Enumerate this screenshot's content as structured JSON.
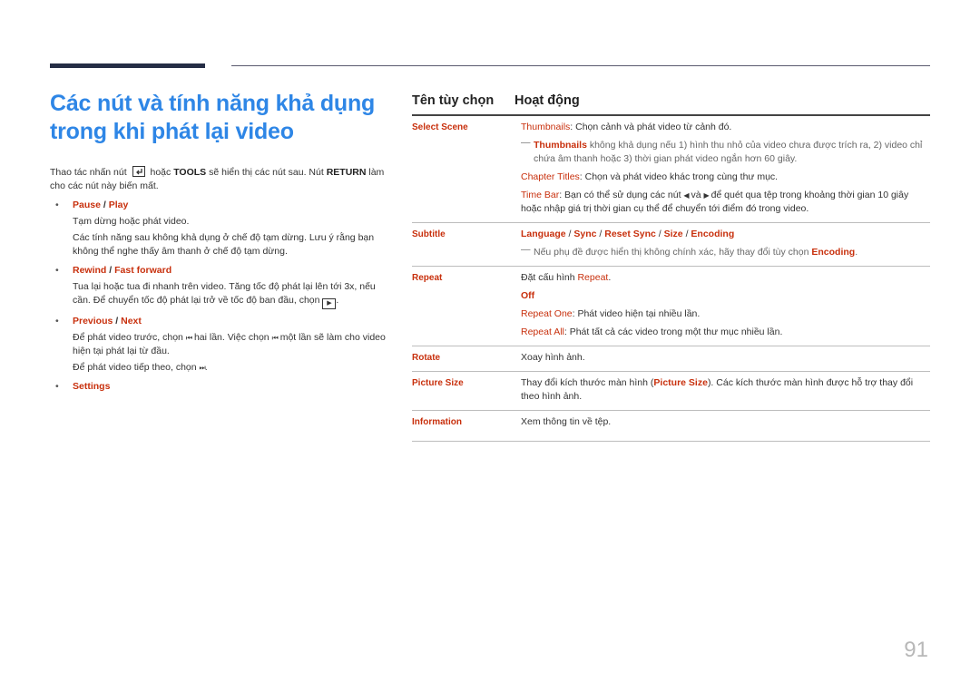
{
  "title": "Các nút và tính năng khả dụng trong khi phát lại video",
  "intro": {
    "before_icon": "Thao tác nhấn nút",
    "icon": "tools-icon",
    "or": "hoặc",
    "tools": "TOOLS",
    "mid": "sẽ hiển thị các nút sau. Nút",
    "return": "RETURN",
    "after": "làm cho các nút này biến mất."
  },
  "bullets": [
    {
      "head": [
        "Pause",
        "Play"
      ],
      "paras": [
        "Tạm dừng hoặc phát video.",
        "Các tính năng sau không khả dụng ở chế độ tạm dừng. Lưu ý rằng bạn không thể nghe thấy âm thanh ở chế độ tạm dừng."
      ]
    },
    {
      "head": [
        "Rewind",
        "Fast forward"
      ],
      "paras": [
        "Tua lại hoặc tua đi nhanh trên video. Tăng tốc độ phát lại lên tới 3x, nếu cần. Để chuyển tốc độ phát lại trở về tốc độ ban đầu, chọn"
      ],
      "icon": "▶",
      "end": "."
    },
    {
      "head": [
        "Previous",
        "Next"
      ],
      "p1a": "Để phát video trước, chọn",
      "p1b": "hai lần. Việc chọn",
      "p1c": "một lần sẽ làm cho video hiện tại phát lại từ đầu.",
      "p2a": "Để phát video tiếp theo, chọn",
      "prev_glyph": "⏮",
      "next_glyph": "⏭"
    },
    {
      "head": [
        "Settings"
      ]
    }
  ],
  "separator": "/",
  "table": {
    "headers": [
      "Tên tùy chọn",
      "Hoạt động"
    ],
    "select_scene": {
      "name": "Select Scene",
      "thumbnails": "Thumbnails",
      "thumbnails_desc": ": Chọn cảnh và phát video từ cảnh đó.",
      "note_desc": "không khả dụng nếu 1) hình thu nhỏ của video chưa được trích ra, 2) video chỉ chứa âm thanh hoặc 3) thời gian phát video ngắn hơn 60 giây.",
      "chapter": "Chapter Titles",
      "chapter_desc": ": Chọn và phát video khác trong cùng thư mục.",
      "timebar": "Time Bar",
      "timebar_a": ": Bạn có thể sử dụng các nút",
      "timebar_b": "và",
      "timebar_c": "để quét qua tệp trong khoảng thời gian 10 giây hoặc nhập giá trị thời gian cụ thể để chuyển tới điểm đó trong video.",
      "left_glyph": "◀",
      "right_glyph": "▶"
    },
    "subtitle": {
      "name": "Subtitle",
      "options": [
        "Language",
        "Sync",
        "Reset Sync",
        "Size",
        "Encoding"
      ],
      "note": "Nếu phụ đề được hiển thị không chính xác, hãy thay đổi tùy chọn",
      "note_hl": "Encoding",
      "note_end": "."
    },
    "repeat": {
      "name": "Repeat",
      "intro": "Đặt cấu hình",
      "intro_hl": "Repeat",
      "off": "Off",
      "one": "Repeat One",
      "one_desc": ": Phát video hiện tại nhiều lần.",
      "all": "Repeat All",
      "all_desc": ": Phát tất cả các video trong một thư mục nhiều lần."
    },
    "rotate": {
      "name": "Rotate",
      "desc": "Xoay hình ảnh."
    },
    "picture_size": {
      "name": "Picture Size",
      "a": "Thay đổi kích thước màn hình (",
      "hl": "Picture Size",
      "b": "). Các kích thước màn hình được hỗ trợ thay đổi theo hình ảnh."
    },
    "information": {
      "name": "Information",
      "desc": "Xem thông tin về tệp."
    }
  },
  "note_dash": "—",
  "page_number": "91",
  "colors": {
    "title": "#2e86e6",
    "highlight": "#c8300d",
    "bar": "#252d45"
  }
}
